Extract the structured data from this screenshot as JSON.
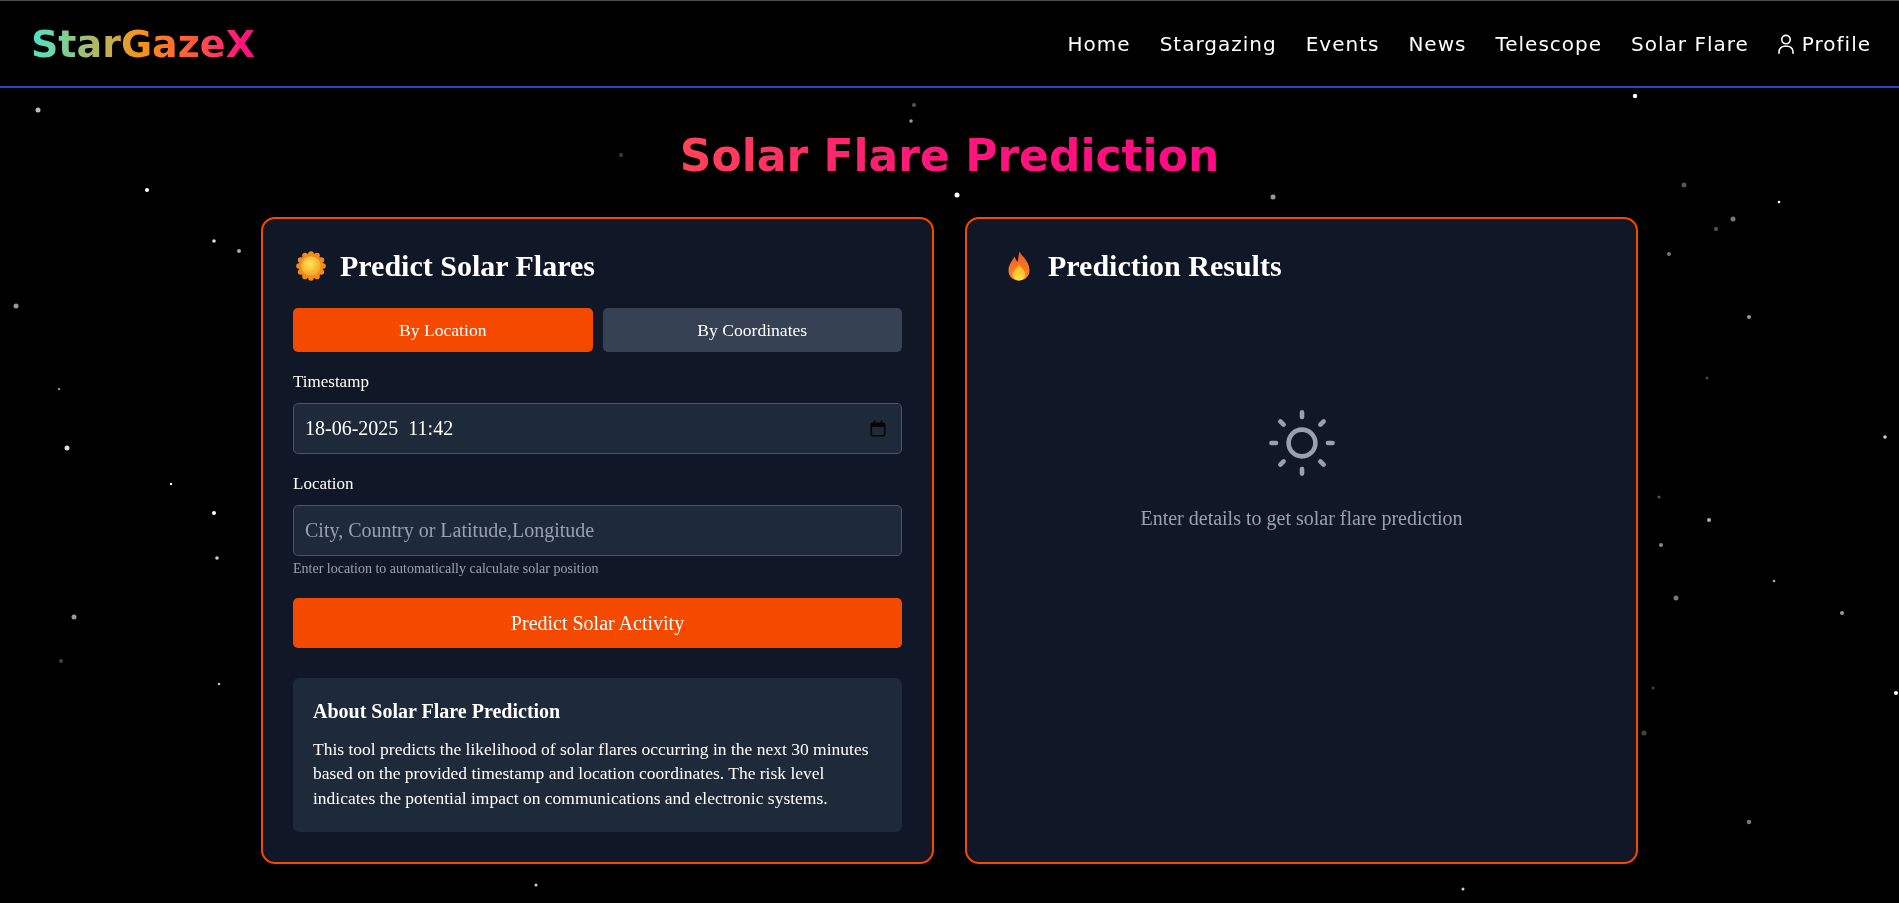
{
  "header": {
    "logo": "StarGazeX",
    "nav": [
      {
        "label": "Home",
        "kind": "link"
      },
      {
        "label": "Stargazing",
        "kind": "link"
      },
      {
        "label": "Events",
        "kind": "link"
      },
      {
        "label": "News",
        "kind": "link"
      },
      {
        "label": "Telescope",
        "kind": "link"
      },
      {
        "label": "Solar Flare",
        "kind": "link"
      },
      {
        "label": "Profile",
        "kind": "profile"
      }
    ]
  },
  "page_title": "Solar Flare Prediction",
  "predict_panel": {
    "title": "Predict Solar Flares",
    "tabs": [
      {
        "label": "By Location",
        "selected": true
      },
      {
        "label": "By Coordinates",
        "selected": false
      }
    ],
    "fields": [
      {
        "kind": "datetime",
        "label": "Timestamp",
        "value": "18-06-2025 11:42"
      },
      {
        "kind": "text",
        "label": "Location",
        "placeholder": "City, Country or Latitude,Longitude",
        "hint": "Enter location to automatically calculate solar position"
      }
    ],
    "submit": "Predict Solar Activity",
    "about": {
      "title": "About Solar Flare Prediction",
      "text": "This tool predicts the likelihood of solar flares occurring in the next 30 minutes based on the provided timestamp and location coordinates. The risk level indicates the potential impact on communications and electronic systems."
    }
  },
  "results_panel": {
    "title": "Prediction Results",
    "empty_message": "Enter details to get solar flare prediction"
  }
}
